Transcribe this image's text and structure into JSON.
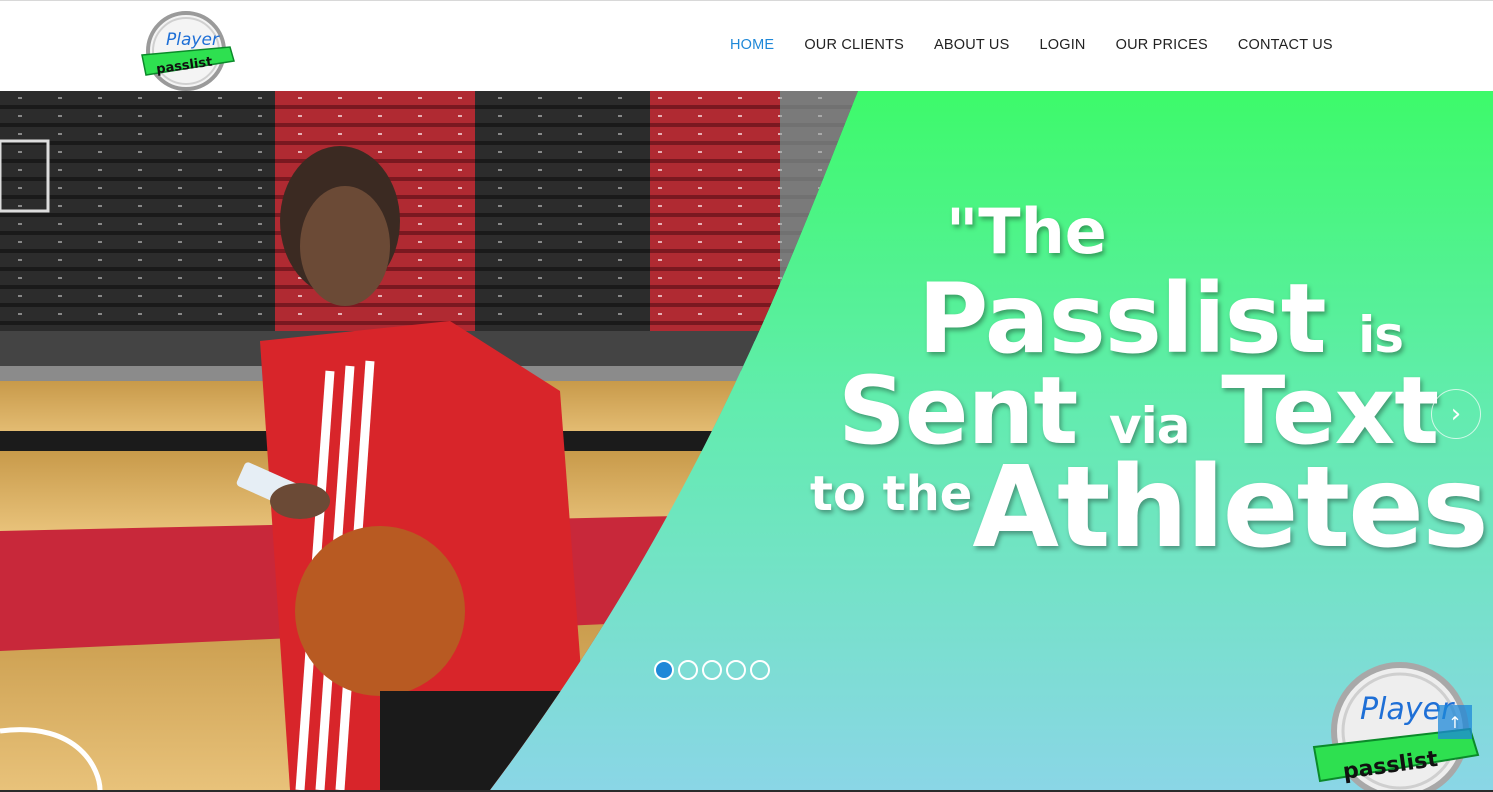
{
  "brand": {
    "logo_top": "Player",
    "logo_bottom": "passlist"
  },
  "nav": {
    "items": [
      {
        "label": "HOME",
        "active": true
      },
      {
        "label": "OUR CLIENTS",
        "active": false
      },
      {
        "label": "ABOUT US",
        "active": false
      },
      {
        "label": "LOGIN",
        "active": false
      },
      {
        "label": "OUR PRICES",
        "active": false
      },
      {
        "label": "CONTACT US",
        "active": false
      }
    ]
  },
  "hero": {
    "line1": "\"The",
    "line2_big": "Passlist",
    "line2_small": "is",
    "line3_big": "Sent",
    "line3_small": "via",
    "line3_big2": "Text",
    "line4_small": "to the",
    "line4_big": "Athletes\"",
    "next_arrow_icon": "chevron-right-icon",
    "slide_count": 5,
    "active_slide": 1
  },
  "colors": {
    "accent": "#1e88d8",
    "hero_green_top": "#3dfa6a",
    "hero_blue_bottom": "#8ad6e6",
    "jacket_red": "#d8252a"
  },
  "scroll_top_icon": "arrow-up-icon"
}
